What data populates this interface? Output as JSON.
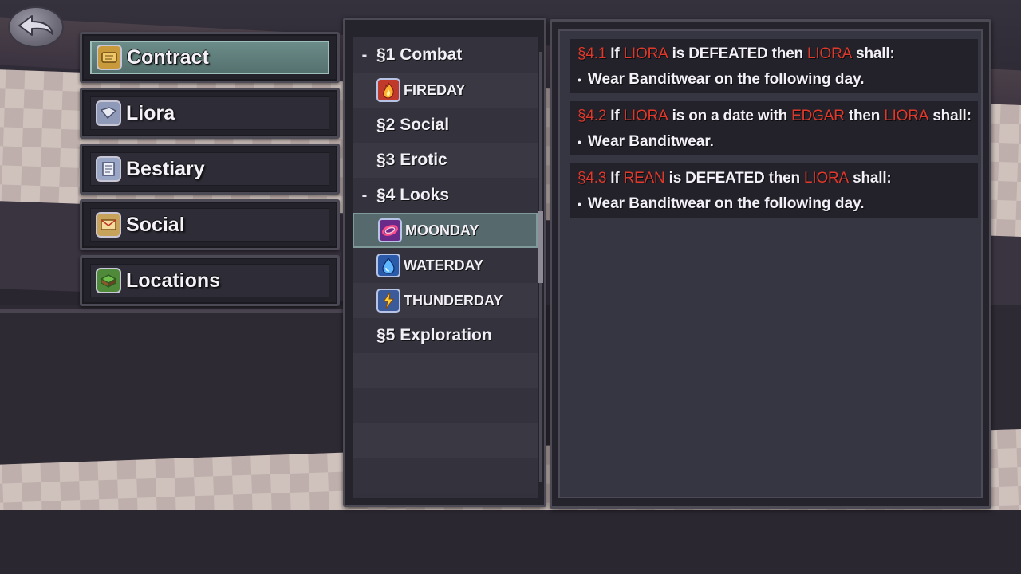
{
  "back_button": {
    "icon": "back-arrow-icon"
  },
  "menu": {
    "items": [
      {
        "label": "Contract",
        "icon": "scroll-icon",
        "active": true
      },
      {
        "label": "Liora",
        "icon": "book-icon",
        "active": false
      },
      {
        "label": "Bestiary",
        "icon": "notes-icon",
        "active": false
      },
      {
        "label": "Social",
        "icon": "letter-icon",
        "active": false
      },
      {
        "label": "Locations",
        "icon": "map-icon",
        "active": false
      }
    ]
  },
  "sections": [
    {
      "toggle": "-",
      "label": "§1 Combat",
      "type": "section"
    },
    {
      "label": "FIREDAY",
      "icon": "fire-icon",
      "type": "sub"
    },
    {
      "toggle": "",
      "label": "§2 Social",
      "type": "section"
    },
    {
      "toggle": "",
      "label": "§3 Erotic",
      "type": "section"
    },
    {
      "toggle": "-",
      "label": "§4 Looks",
      "type": "section"
    },
    {
      "label": "MOONDAY",
      "icon": "moon-icon",
      "type": "sub",
      "selected": true
    },
    {
      "label": "WATERDAY",
      "icon": "water-drop-icon",
      "type": "sub"
    },
    {
      "label": "THUNDERDAY",
      "icon": "lightning-icon",
      "type": "sub"
    },
    {
      "toggle": "",
      "label": "§5 Exploration",
      "type": "section"
    }
  ],
  "rules": [
    {
      "num": "§4.1",
      "parts": [
        " If ",
        "LIORA",
        " is DEFEATED then ",
        "LIORA",
        " shall:"
      ],
      "item": "Wear Banditwear on the following day."
    },
    {
      "num": "§4.2",
      "parts": [
        " If ",
        "LIORA",
        " is on a date with ",
        "EDGAR",
        " then ",
        "LIORA",
        " shall:"
      ],
      "item": "Wear Banditwear."
    },
    {
      "num": "§4.3",
      "parts": [
        " If ",
        "REAN",
        " is DEFEATED then ",
        "LIORA",
        " shall:"
      ],
      "item": "Wear Banditwear on the following day."
    }
  ],
  "bullet": "•",
  "colors": {
    "highlight": "#e0392b",
    "selected_row": "#566a6d",
    "active_menu": "#607e7b"
  }
}
